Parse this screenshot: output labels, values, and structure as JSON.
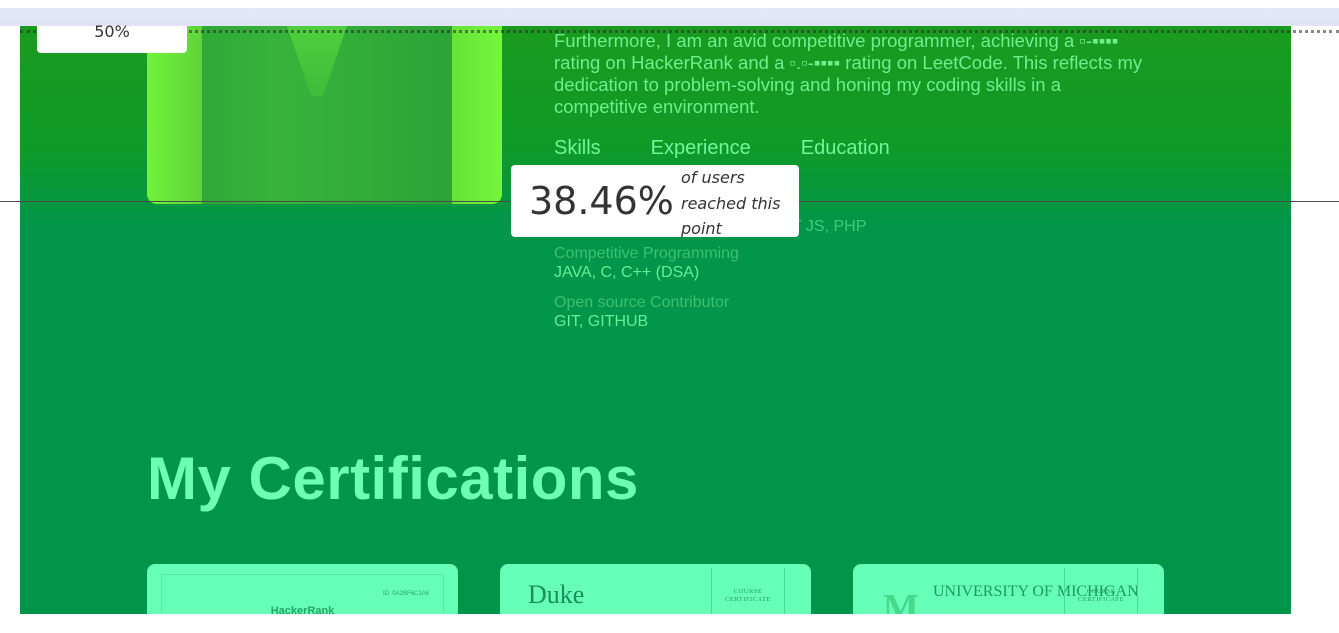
{
  "about": {
    "text": "Furthermore, I am an avid competitive programmer, achieving a ▫-▪▪▪▪ rating on HackerRank and a ▫.▫-▪▪▪▪ rating on LeetCode. This reflects my dedication to problem-solving and honing my coding skills in a competitive environment."
  },
  "tabs": [
    {
      "label": "Skills"
    },
    {
      "label": "Experience"
    },
    {
      "label": "Education"
    }
  ],
  "skills": {
    "first_value_fragment": "T JS, PHP",
    "groups": [
      {
        "title": "Competitive Programming",
        "value": "JAVA, C, C++ (DSA)"
      },
      {
        "title": "Open source Contributor",
        "value": "GIT, GITHUB"
      }
    ]
  },
  "certifications": {
    "heading": "My Certifications",
    "cards": [
      {
        "brand": "HackerRank",
        "id_text": "ID: 0A2BF6C1A6"
      },
      {
        "brand": "Duke",
        "cert_label": "COURSE CERTIFICATE"
      },
      {
        "brand": "UNIVERSITY OF MICHIGAN",
        "logo": "M",
        "cert_label": "COURSE CERTIFICATE"
      }
    ]
  },
  "overlay": {
    "top_percent": "50%",
    "reached_percent": "38.46%",
    "reached_caption": "of users reached this point"
  }
}
